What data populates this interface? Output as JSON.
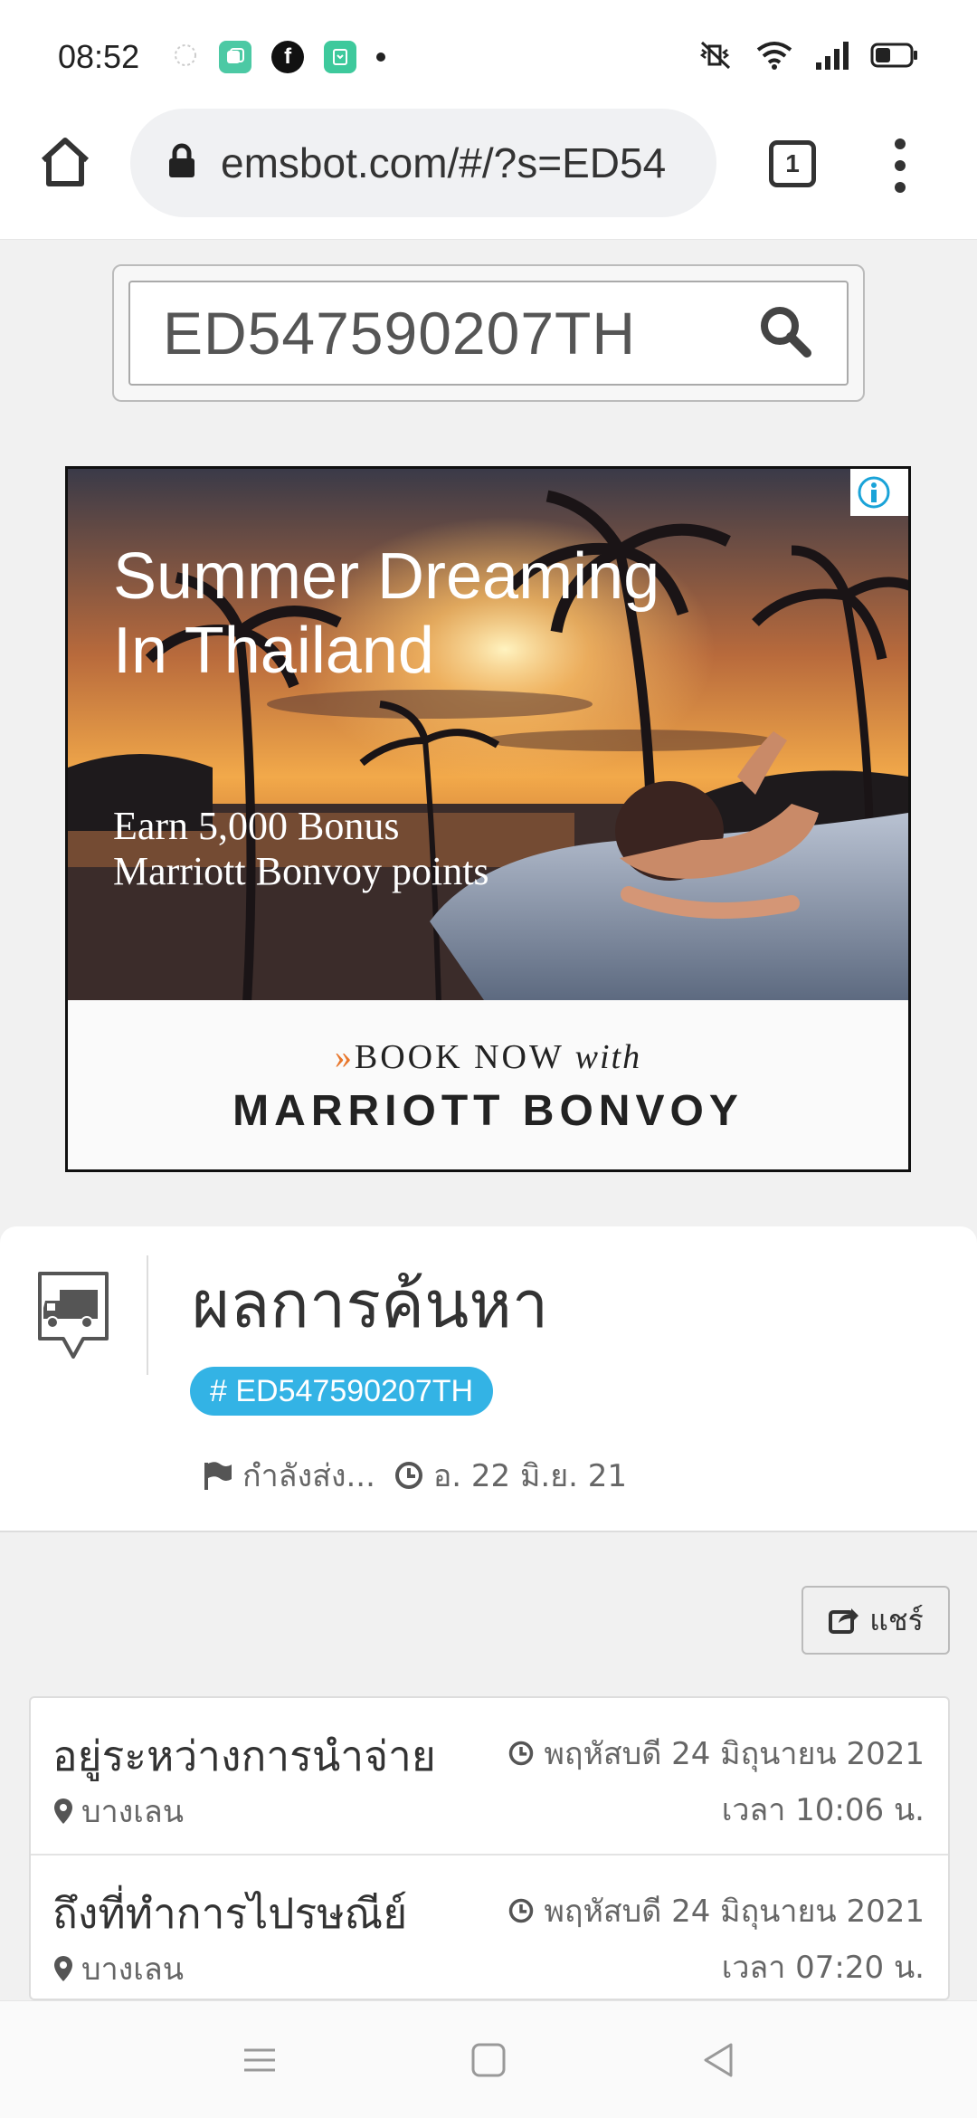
{
  "status_bar": {
    "time": "08:52",
    "notification_icons": [
      "signal-app-icon",
      "messages-icon",
      "facebook-icon",
      "app-icon"
    ],
    "status_icons": [
      "vibrate-mute-icon",
      "wifi-icon",
      "cell-signal-icon",
      "battery-icon"
    ]
  },
  "browser": {
    "url": "emsbot.com/#/?s=ED54",
    "tab_count": "1"
  },
  "search": {
    "value": "ED547590207TH"
  },
  "ad": {
    "headline_line1": "Summer Dreaming",
    "headline_line2": "In Thailand",
    "sub_line1": "Earn 5,000 Bonus",
    "sub_line2": "Marriott Bonvoy points",
    "cta_arrow": "»",
    "cta_text": "BOOK NOW",
    "cta_with": "with",
    "brand": "MARRIOTT BONVOY"
  },
  "result": {
    "title": "ผลการค้นหา",
    "tracking_badge": "# ED547590207TH",
    "status_text": "กำลังส่ง...",
    "date_text": "อ. 22 มิ.ย. 21"
  },
  "share": {
    "label": "แชร์"
  },
  "timeline": [
    {
      "status": "อยู่ระหว่างการนำจ่าย",
      "location": "บางเลน",
      "date": "พฤหัสบดี 24 มิถุนายน 2021",
      "time": "เวลา 10:06 น."
    },
    {
      "status": "ถึงที่ทำการไปรษณีย์",
      "location": "บางเลน",
      "date": "พฤหัสบดี 24 มิถุนายน 2021",
      "time": "เวลา 07:20 น."
    }
  ],
  "colors": {
    "badge": "#33b3e5",
    "ad_arrow": "#e8762b"
  }
}
